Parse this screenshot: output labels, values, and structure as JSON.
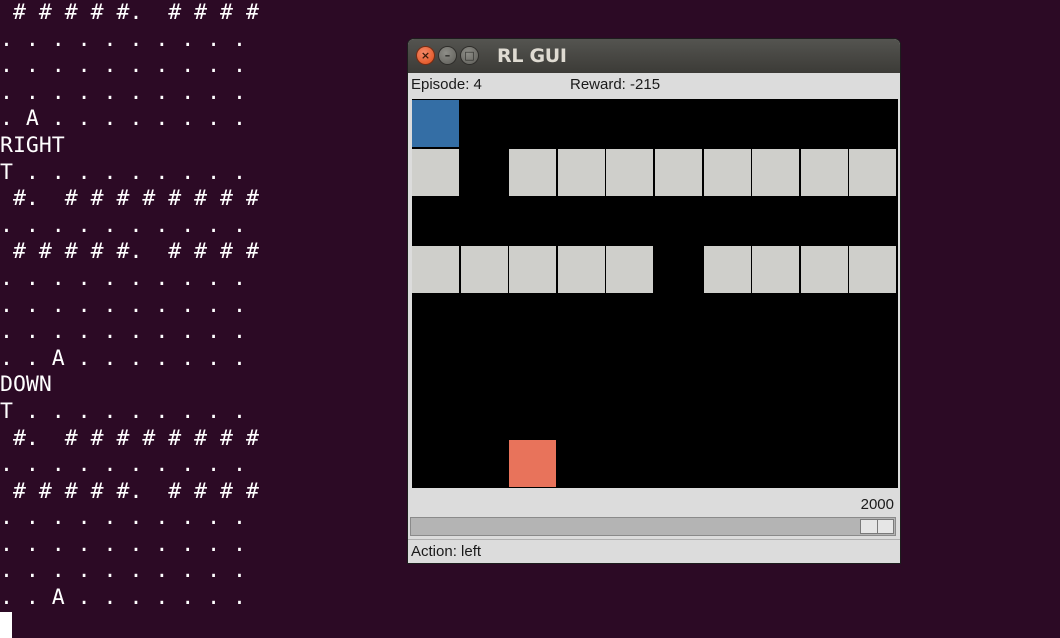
{
  "terminal": {
    "lines": [
      " # # # # #.  # # # #",
      ". . . . . . . . . .",
      ". . . . . . . . . .",
      ". . . . . . . . . .",
      ". A . . . . . . . .",
      "RIGHT",
      "T . . . . . . . . .",
      " #.  # # # # # # # #",
      ". . . . . . . . . .",
      " # # # # #.  # # # #",
      ". . . . . . . . . .",
      ". . . . . . . . . .",
      ". . . . . . . . . .",
      ". . A . . . . . . .",
      "DOWN",
      "T . . . . . . . . .",
      " #.  # # # # # # # #",
      ". . . . . . . . . .",
      " # # # # #.  # # # #",
      ". . . . . . . . . .",
      ". . . . . . . . . .",
      ". . . . . . . . . .",
      ". . A . . . . . . ."
    ]
  },
  "window": {
    "title": "RL GUI",
    "close_glyph": "×",
    "min_glyph": "–",
    "max_glyph": "□"
  },
  "status": {
    "episode": "Episode: 4",
    "reward": "Reward: -215",
    "action": "Action: left"
  },
  "speed": {
    "value": "2000",
    "slider_fraction": 1.0
  },
  "grid": {
    "cols": 10,
    "rows": 8,
    "agent": [
      0,
      0
    ],
    "goal": [
      2,
      7
    ],
    "walls": [
      [
        0,
        1
      ],
      [
        2,
        1
      ],
      [
        3,
        1
      ],
      [
        4,
        1
      ],
      [
        5,
        1
      ],
      [
        6,
        1
      ],
      [
        7,
        1
      ],
      [
        8,
        1
      ],
      [
        9,
        1
      ],
      [
        0,
        3
      ],
      [
        1,
        3
      ],
      [
        2,
        3
      ],
      [
        3,
        3
      ],
      [
        4,
        3
      ],
      [
        6,
        3
      ],
      [
        7,
        3
      ],
      [
        8,
        3
      ],
      [
        9,
        3
      ]
    ]
  },
  "colors": {
    "background": "#2c0a25",
    "agent": "#346ea5",
    "goal": "#e8735b",
    "wall": "#cfcfcb",
    "empty": "#000000"
  }
}
